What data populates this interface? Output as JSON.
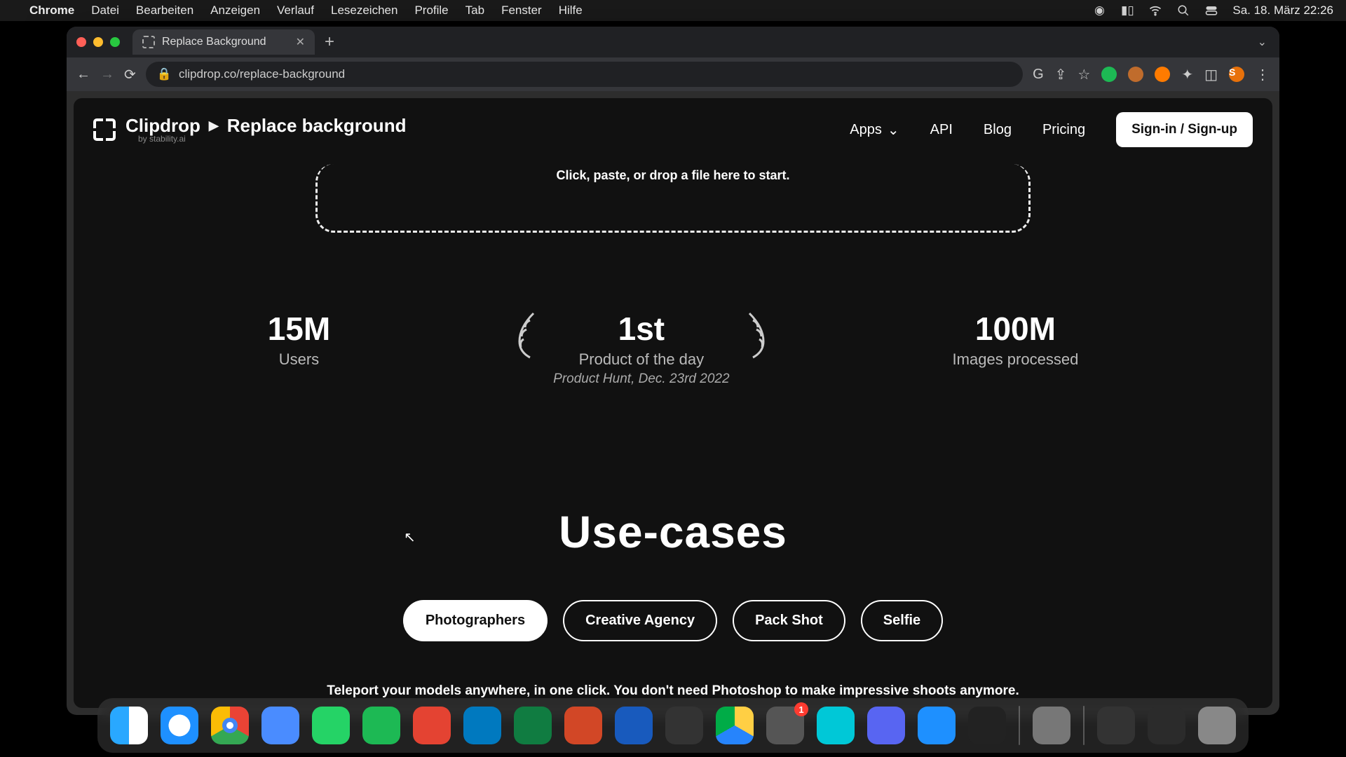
{
  "menubar": {
    "app": "Chrome",
    "items": [
      "Datei",
      "Bearbeiten",
      "Anzeigen",
      "Verlauf",
      "Lesezeichen",
      "Profile",
      "Tab",
      "Fenster",
      "Hilfe"
    ],
    "date": "Sa. 18. März  22:26"
  },
  "chrome": {
    "tab_title": "Replace Background",
    "url": "clipdrop.co/replace-background",
    "avatar_letter": "S"
  },
  "page": {
    "brand": "Clipdrop",
    "brand_sub": "by stability.ai",
    "breadcrumb": "Replace background",
    "nav": {
      "apps": "Apps",
      "api": "API",
      "blog": "Blog",
      "pricing": "Pricing"
    },
    "signin": "Sign-in / Sign-up",
    "dropzone_text": "Click, paste, or drop a file here to start.",
    "stats": {
      "users_val": "15M",
      "users_lbl": "Users",
      "rank_val": "1st",
      "rank_lbl": "Product of the day",
      "rank_sub": "Product Hunt, Dec. 23rd 2022",
      "img_val": "100M",
      "img_lbl": "Images processed"
    },
    "usecases": {
      "title": "Use-cases",
      "tabs": [
        "Photographers",
        "Creative Agency",
        "Pack Shot",
        "Selfie"
      ],
      "active": 0,
      "desc": "Teleport your models anywhere, in one click. You don't need Photoshop to make impressive shoots anymore."
    }
  },
  "dock": {
    "settings_badge": "1"
  }
}
